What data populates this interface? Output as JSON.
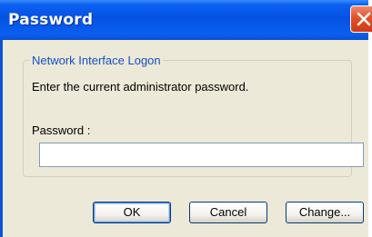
{
  "window": {
    "title": "Password",
    "close_icon": "close-icon"
  },
  "colors": {
    "titlebar": "#0552e2",
    "dialog_bg": "#ece9d8",
    "close_button": "#e4502a",
    "group_label": "#1250c8"
  },
  "group": {
    "label": "Network Interface Logon",
    "instruction": "Enter the current administrator password.",
    "password_label": "Password :",
    "password_value": "",
    "password_placeholder": ""
  },
  "buttons": {
    "ok": "OK",
    "cancel": "Cancel",
    "change": "Change..."
  }
}
